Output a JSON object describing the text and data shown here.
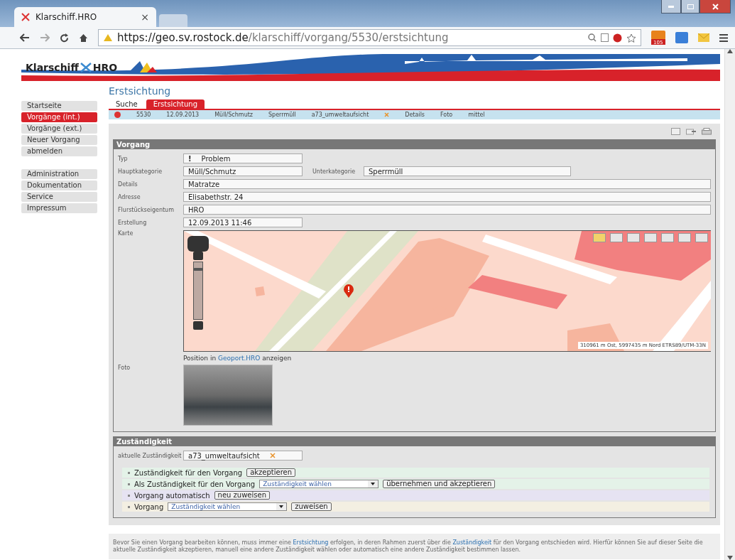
{
  "browser": {
    "tab_title": "Klarschiff.HRO",
    "tab_close": "×",
    "url_host": "https://geo.sv.rostock.de",
    "url_path": "/klarschiff/vorgang/5530/erstsichtung",
    "badge": "105"
  },
  "header": {
    "logo_left": "Klarschiff",
    "logo_right": "HRO"
  },
  "sidebar": {
    "groups": [
      [
        {
          "label": "Startseite",
          "selected": false
        },
        {
          "label": "Vorgänge (int.)",
          "selected": true
        },
        {
          "label": "Vorgänge (ext.)",
          "selected": false
        },
        {
          "label": "Neuer Vorgang",
          "selected": false
        },
        {
          "label": "abmelden",
          "selected": false
        }
      ],
      [
        {
          "label": "Administration",
          "selected": false
        },
        {
          "label": "Dokumentation",
          "selected": false
        },
        {
          "label": "Service",
          "selected": false
        },
        {
          "label": "Impressum",
          "selected": false
        }
      ]
    ]
  },
  "page_title": "Erstsichtung",
  "tabs": [
    {
      "label": "Suche",
      "selected": false
    },
    {
      "label": "Erstsichtung",
      "selected": true
    }
  ],
  "summary": {
    "id": "5530",
    "date": "12.09.2013",
    "category": "Müll/Schmutz",
    "subcategory": "Sperrmüll",
    "responsibility": "a73_umweltaufsicht",
    "details": "Details",
    "photo": "Foto",
    "priority": "mittel"
  },
  "vorgang": {
    "title": "Vorgang",
    "rows": [
      [
        {
          "label": "Typ",
          "value": "Problem",
          "kind": "short",
          "icon": "!"
        }
      ],
      [
        {
          "label": "Hauptkategorie",
          "value": "Müll/Schmutz",
          "kind": "short"
        },
        {
          "label": "Unterkategorie",
          "value": "Sperrmüll",
          "kind": "medium"
        }
      ],
      [
        {
          "label": "Details",
          "value": "Matratze",
          "kind": "full"
        }
      ],
      [
        {
          "label": "Adresse",
          "value": "Elisabethstr. 24",
          "kind": "full"
        }
      ],
      [
        {
          "label": "Flurstückseigentum",
          "value": "HRO",
          "kind": "full"
        }
      ],
      [
        {
          "label": "Erstellung",
          "value": "12.09.2013 11:46",
          "kind": "short"
        }
      ]
    ],
    "map_zoom": {
      "level": 0.9
    },
    "map_label": "Karte",
    "map_coords": "310961 m Ost, 5997435 m Nord ETRS89/UTM-33N",
    "map_link": {
      "before": "Position in",
      "link": "Geoport.HRO",
      "after": "anzeigen"
    },
    "photo_label": "Foto"
  },
  "zustaendigkeit": {
    "title": "Zuständigkeit",
    "current_label": "aktuelle Zuständigkeit",
    "current_value": "a73_umweltaufsicht",
    "actions": [
      {
        "kind": "button",
        "text": "Zuständigkeit für den Vorgang",
        "button": "akzeptieren",
        "color": "#e4f2e8"
      },
      {
        "kind": "select",
        "text": "Als Zuständigkeit für den Vorgang",
        "select": "Zuständigkeit wählen",
        "button": "übernehmen und akzeptieren",
        "color": "#e4f2e8"
      },
      {
        "kind": "button",
        "text": "Vorgang automatisch",
        "button": "neu zuweisen",
        "color": "#e6e3f2"
      },
      {
        "kind": "select",
        "text": "Vorgang",
        "select": "Zuständigkeit wählen",
        "button": "zuweisen",
        "color": "#f3efe2"
      }
    ]
  },
  "footer": [
    {
      "text": "Bevor Sie einen Vorgang bearbeiten können, muss immer eine ",
      "link": false
    },
    {
      "text": "Erstsichtung",
      "link": true
    },
    {
      "text": " erfolgen, in deren Rahmen zuerst über die ",
      "link": false
    },
    {
      "text": "Zuständigkeit",
      "link": true
    },
    {
      "text": " für den Vorgang entschieden wird. Hierfür können Sie auf dieser Seite die aktuelle Zuständigkeit akzeptieren, manuell eine andere Zuständigkeit wählen oder automatisch eine andere Zuständigkeit bestimmen lassen.",
      "link": false
    }
  ]
}
